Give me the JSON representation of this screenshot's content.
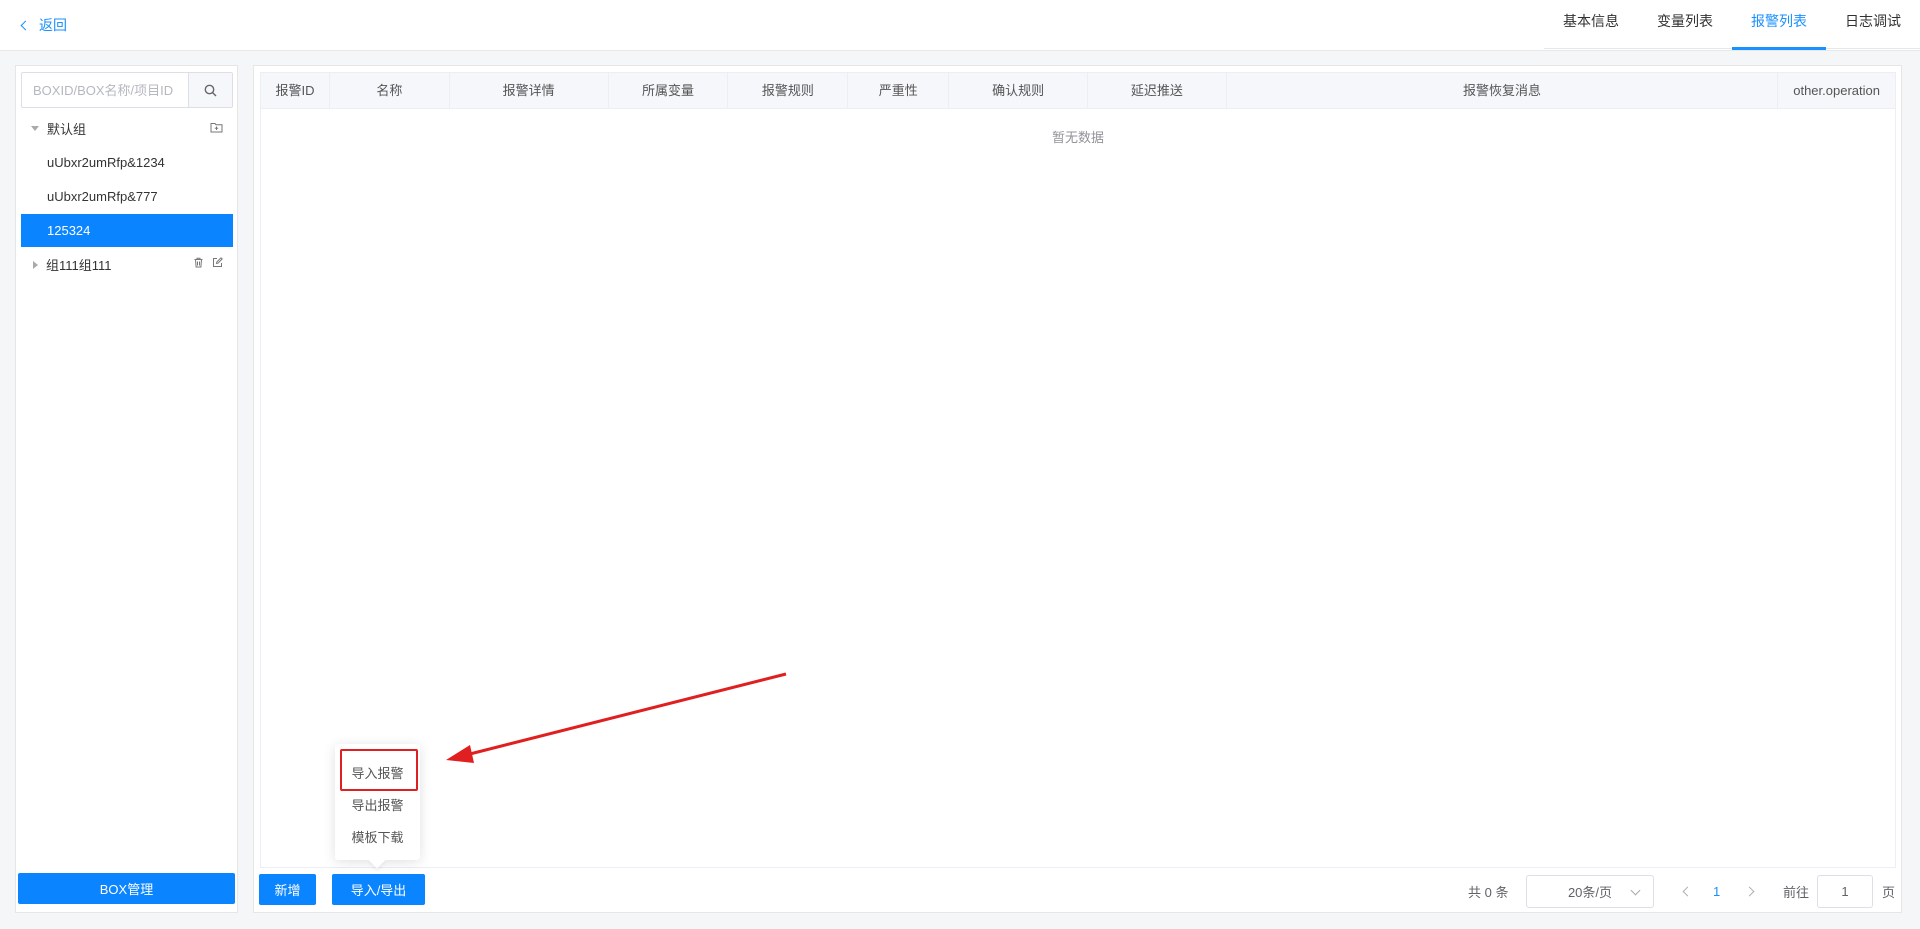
{
  "header": {
    "back_label": "返回",
    "tabs": [
      {
        "label": "基本信息"
      },
      {
        "label": "变量列表"
      },
      {
        "label": "报警列表"
      },
      {
        "label": "日志调试"
      }
    ]
  },
  "sidebar": {
    "search_placeholder": "BOXID/BOX名称/项目ID",
    "tree": [
      {
        "label": "默认组"
      },
      {
        "label": "uUbxr2umRfp&1234"
      },
      {
        "label": "uUbxr2umRfp&777"
      },
      {
        "label": "125324"
      },
      {
        "label": "组111组111"
      }
    ],
    "box_button": "BOX管理"
  },
  "table": {
    "columns": [
      "报警ID",
      "名称",
      "报警详情",
      "所属变量",
      "报警规则",
      "严重性",
      "确认规则",
      "延迟推送",
      "报警恢复消息",
      "other.operation"
    ],
    "empty_text": "暂无数据"
  },
  "actions": {
    "add_label": "新增",
    "import_export_label": "导入/导出",
    "dropdown": [
      "导入报警",
      "导出报警",
      "模板下载"
    ]
  },
  "pagination": {
    "total": "共 0 条",
    "page_size": "20条/页",
    "current_page": "1",
    "goto_label": "前往",
    "goto_value": "1",
    "page_suffix": "页"
  },
  "colors": {
    "accent": "#1890ff",
    "button": "#0a84ff",
    "annotation": "#e02020"
  }
}
